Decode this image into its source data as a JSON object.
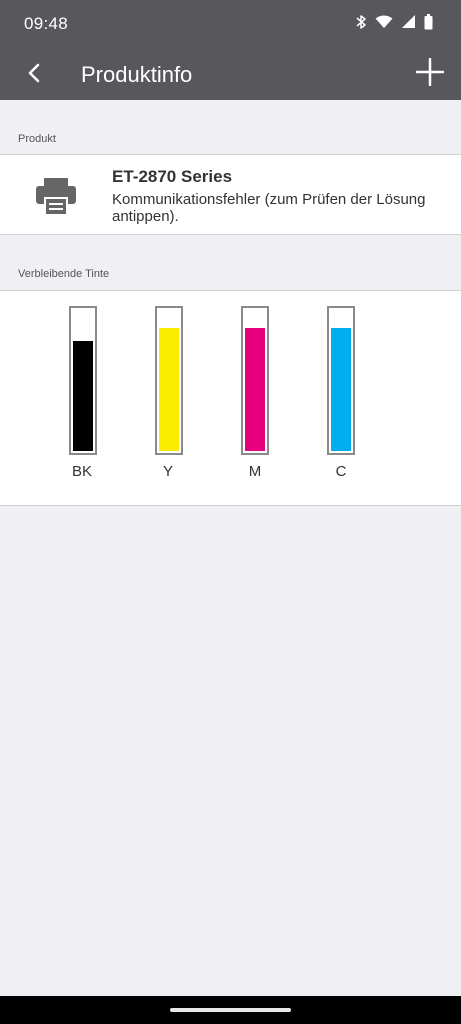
{
  "status_bar": {
    "time": "09:48",
    "icons": [
      "bluetooth-icon",
      "wifi-icon",
      "cellular-signal-icon",
      "battery-icon"
    ]
  },
  "app_bar": {
    "title": "Produktinfo",
    "back_icon": "chevron-left-icon",
    "add_icon": "plus-icon"
  },
  "product_section": {
    "header": "Produkt",
    "icon": "printer-icon",
    "name": "ET-2870 Series",
    "status": "Kommunikationsfehler (zum Prüfen der Lösung antippen)."
  },
  "ink_section": {
    "header": "Verbleibende Tinte",
    "inks": [
      {
        "label": "BK",
        "color": "#000000",
        "level": 0.78
      },
      {
        "label": "Y",
        "color": "#fcec00",
        "level": 0.87
      },
      {
        "label": "M",
        "color": "#e4007f",
        "level": 0.87
      },
      {
        "label": "C",
        "color": "#00aeef",
        "level": 0.87
      }
    ]
  },
  "colors": {
    "app_bar": "#58585c",
    "background": "#f0eff4"
  }
}
